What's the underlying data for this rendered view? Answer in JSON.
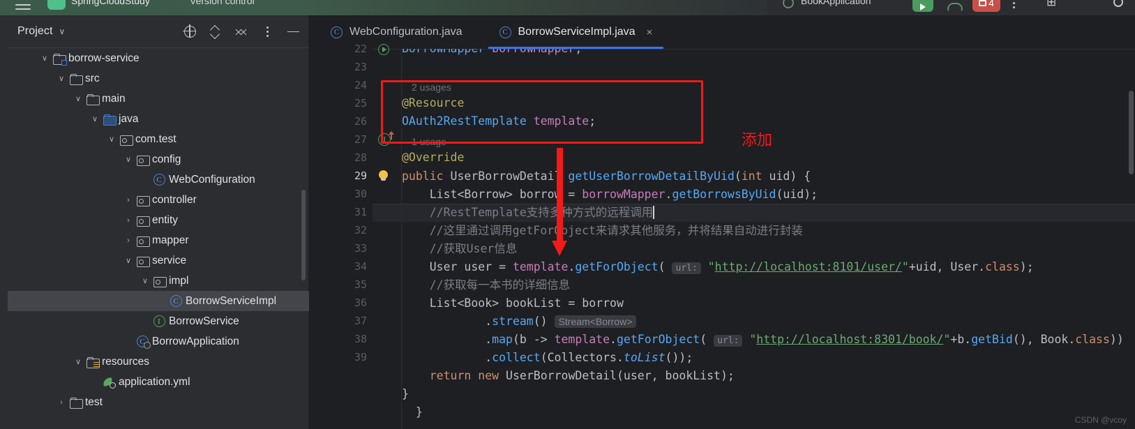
{
  "topbar": {
    "menu_icon": "hamburger-icon",
    "project_name": "SpringCloudStudy",
    "vcs_label": "Version control",
    "run_config": "BookApplication",
    "run_icon": "run-icon",
    "debug_icon": "debug-icon",
    "error_count": "4",
    "more_icon": "kebab-icon",
    "add_user_icon": "add-user-icon",
    "search_icon": "search-icon"
  },
  "sidebar": {
    "title": "Project",
    "chevron": "∨",
    "actions": [
      {
        "name": "locate-icon",
        "tooltip": "Select Opened File"
      },
      {
        "name": "expand-all-icon",
        "tooltip": "Expand All"
      },
      {
        "name": "collapse-all-icon",
        "tooltip": "Collapse All"
      },
      {
        "name": "options-kebab-icon",
        "tooltip": "Options"
      },
      {
        "name": "hide-icon",
        "tooltip": "Hide"
      }
    ],
    "tree": [
      {
        "label": "borrow-service",
        "indent": 1,
        "arrow": "∨",
        "icon": "module-folder-icon",
        "selected": false
      },
      {
        "label": "src",
        "indent": 2,
        "arrow": "∨",
        "icon": "folder-icon",
        "selected": false
      },
      {
        "label": "main",
        "indent": 3,
        "arrow": "∨",
        "icon": "folder-icon",
        "selected": false
      },
      {
        "label": "java",
        "indent": 4,
        "arrow": "∨",
        "icon": "source-folder-icon",
        "selected": false
      },
      {
        "label": "com.test",
        "indent": 5,
        "arrow": "∨",
        "icon": "package-icon",
        "selected": false
      },
      {
        "label": "config",
        "indent": 6,
        "arrow": "∨",
        "icon": "package-icon",
        "selected": false
      },
      {
        "label": "WebConfiguration",
        "indent": 7,
        "arrow": "",
        "icon": "java-class-icon",
        "selected": false
      },
      {
        "label": "controller",
        "indent": 6,
        "arrow": "›",
        "icon": "package-icon",
        "selected": false
      },
      {
        "label": "entity",
        "indent": 6,
        "arrow": "›",
        "icon": "package-icon",
        "selected": false
      },
      {
        "label": "mapper",
        "indent": 6,
        "arrow": "›",
        "icon": "package-icon",
        "selected": false
      },
      {
        "label": "service",
        "indent": 6,
        "arrow": "∨",
        "icon": "package-icon",
        "selected": false
      },
      {
        "label": "impl",
        "indent": 7,
        "arrow": "∨",
        "icon": "package-icon",
        "selected": false
      },
      {
        "label": "BorrowServiceImpl",
        "indent": 8,
        "arrow": "",
        "icon": "java-class-icon",
        "selected": true
      },
      {
        "label": "BorrowService",
        "indent": 7,
        "arrow": "",
        "icon": "java-interface-icon",
        "selected": false
      },
      {
        "label": "BorrowApplication",
        "indent": 6,
        "arrow": "",
        "icon": "spring-class-icon",
        "selected": false
      },
      {
        "label": "resources",
        "indent": 3,
        "arrow": "∨",
        "icon": "resources-folder-icon",
        "selected": false
      },
      {
        "label": "application.yml",
        "indent": 4,
        "arrow": "",
        "icon": "spring-yaml-icon",
        "selected": false
      },
      {
        "label": "test",
        "indent": 2,
        "arrow": "›",
        "icon": "folder-icon",
        "selected": false
      }
    ]
  },
  "editor": {
    "tabs": [
      {
        "label": "WebConfiguration.java",
        "icon": "java-class-icon",
        "active": false,
        "closable": false
      },
      {
        "label": "BorrowServiceImpl.java",
        "icon": "java-class-icon",
        "active": true,
        "closable": true,
        "close_glyph": "×"
      }
    ],
    "current_line": 29,
    "line_numbers": [
      22,
      23,
      24,
      25,
      26,
      27,
      28,
      29,
      30,
      31,
      32,
      33,
      34,
      35,
      36,
      37,
      38,
      39
    ],
    "inlay_hints": [
      {
        "text": "2 usages",
        "line": 24
      },
      {
        "text": "1 usage",
        "line": 26
      }
    ],
    "gutter_marks": [
      {
        "line": 22,
        "icon": "run-gutter-icon"
      },
      {
        "line": 27,
        "icon": "implementing-method-icon",
        "letter": "I"
      },
      {
        "line": 29,
        "icon": "intention-bulb-icon"
      }
    ],
    "code_lines": {
      "l22": "BorrowMapper borrowMapper;",
      "l24": "@Resource",
      "l25": "OAuth2RestTemplate template;",
      "l26": "@Override",
      "l27": "public UserBorrowDetail getUserBorrowDetailByUid(int uid) {",
      "l28": "    List<Borrow> borrow = borrowMapper.getBorrowsByUid(uid);",
      "l29": "    //RestTemplate支持多种方式的远程调用",
      "l30": "    //这里通过调用getForObject来请求其他服务，并将结果自动进行封装",
      "l31": "    //获取User信息",
      "l32": "    User user = template.getForObject( url: \"http://localhost:8101/user/\"+uid, User.class);",
      "l33": "    //获取每一本书的详细信息",
      "l34": "    List<Book> bookList = borrow",
      "l35": "            .stream() Stream<Borrow>",
      "l36": "            .map(b -> template.getForObject( url: \"http://localhost:8301/book/\"+b.getBid(), Book.class))",
      "l37": "            .collect(Collectors.toList());",
      "l38": "    return new UserBorrowDetail(user, bookList);",
      "l39": "}"
    },
    "parameter_hints": [
      {
        "line": 32,
        "text": "url:"
      },
      {
        "line": 36,
        "text": "url:"
      }
    ],
    "type_hints": [
      {
        "line": 35,
        "text": "Stream<Borrow>"
      }
    ],
    "urls": [
      {
        "line": 32,
        "text": "http://localhost:8101/user/"
      },
      {
        "line": 36,
        "text": "http://localhost:8301/book/"
      }
    ]
  },
  "annotations": {
    "box_color": "#f21a1a",
    "label": "添加",
    "arrow_color": "#f31a1a"
  },
  "watermark": "CSDN @vcoy"
}
